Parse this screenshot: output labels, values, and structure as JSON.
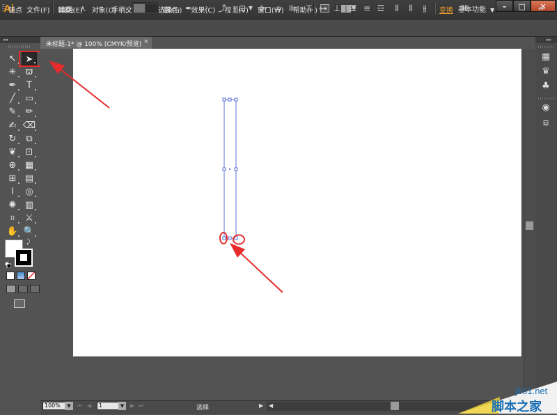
{
  "app": {
    "logo": "Ai"
  },
  "menu": {
    "items": [
      "文件(F)",
      "编辑(E)",
      "对象(O)",
      "文字(T)",
      "选择(S)",
      "效果(C)",
      "视图(V)",
      "窗口(W)",
      "帮助(H)"
    ],
    "workspace": "基本功能"
  },
  "window_controls": {
    "minimize": "–",
    "maximize": "□",
    "close": "✕"
  },
  "control_bar": {
    "anchor_label": "锚点",
    "convert_label": "转换:",
    "handles_label": "手柄:",
    "anchor_points_label": "锚点:",
    "transform_label": "变换"
  },
  "document_tab": {
    "title": "未标题-1* @ 100% (CMYK/预览)",
    "close": "×"
  },
  "status_bar": {
    "zoom": "100%",
    "page": "1",
    "current_tool": "选择",
    "nav_first": "⏮",
    "nav_prev": "◀",
    "nav_next": "▶",
    "nav_last": "⏭",
    "caret": "▼",
    "play_arrow": "▶",
    "h_left_arrow": "◀"
  },
  "tools": [
    {
      "name": "selection-tool",
      "glyph": "↖"
    },
    {
      "name": "direct-selection-tool",
      "glyph": "➤"
    },
    {
      "name": "magic-wand-tool",
      "glyph": "✳"
    },
    {
      "name": "lasso-tool",
      "glyph": "ϖ"
    },
    {
      "name": "pen-tool",
      "glyph": "✒"
    },
    {
      "name": "type-tool",
      "glyph": "T"
    },
    {
      "name": "line-segment-tool",
      "glyph": "╱"
    },
    {
      "name": "rectangle-tool",
      "glyph": "▭"
    },
    {
      "name": "paintbrush-tool",
      "glyph": "✎"
    },
    {
      "name": "pencil-tool",
      "glyph": "✏"
    },
    {
      "name": "blob-brush-tool",
      "glyph": "✍"
    },
    {
      "name": "eraser-tool",
      "glyph": "⌫"
    },
    {
      "name": "rotate-tool",
      "glyph": "↻"
    },
    {
      "name": "scale-tool",
      "glyph": "⧉"
    },
    {
      "name": "warp-tool",
      "glyph": "❦"
    },
    {
      "name": "free-transform-tool",
      "glyph": "⊡"
    },
    {
      "name": "shape-builder-tool",
      "glyph": "⊕"
    },
    {
      "name": "perspective-grid-tool",
      "glyph": "▦"
    },
    {
      "name": "mesh-tool",
      "glyph": "⊞"
    },
    {
      "name": "gradient-tool",
      "glyph": "▤"
    },
    {
      "name": "eyedropper-tool",
      "glyph": "⌇"
    },
    {
      "name": "blend-tool",
      "glyph": "◎"
    },
    {
      "name": "symbol-sprayer-tool",
      "glyph": "✺"
    },
    {
      "name": "column-graph-tool",
      "glyph": "▥"
    },
    {
      "name": "artboard-tool",
      "glyph": "⌗"
    },
    {
      "name": "slice-tool",
      "glyph": "⚔"
    },
    {
      "name": "hand-tool",
      "glyph": "✋"
    },
    {
      "name": "zoom-tool",
      "glyph": "🔍"
    }
  ],
  "right_panel_icons": [
    "color-guide-icon",
    "brushes-icon",
    "symbols-icon",
    "appearance-icon",
    "graphic-styles-icon"
  ],
  "annotation_color": "#e62b2b",
  "path_color": "#5b6fd0",
  "watermark": {
    "url": "jb51.net",
    "name": "脚本之家"
  }
}
